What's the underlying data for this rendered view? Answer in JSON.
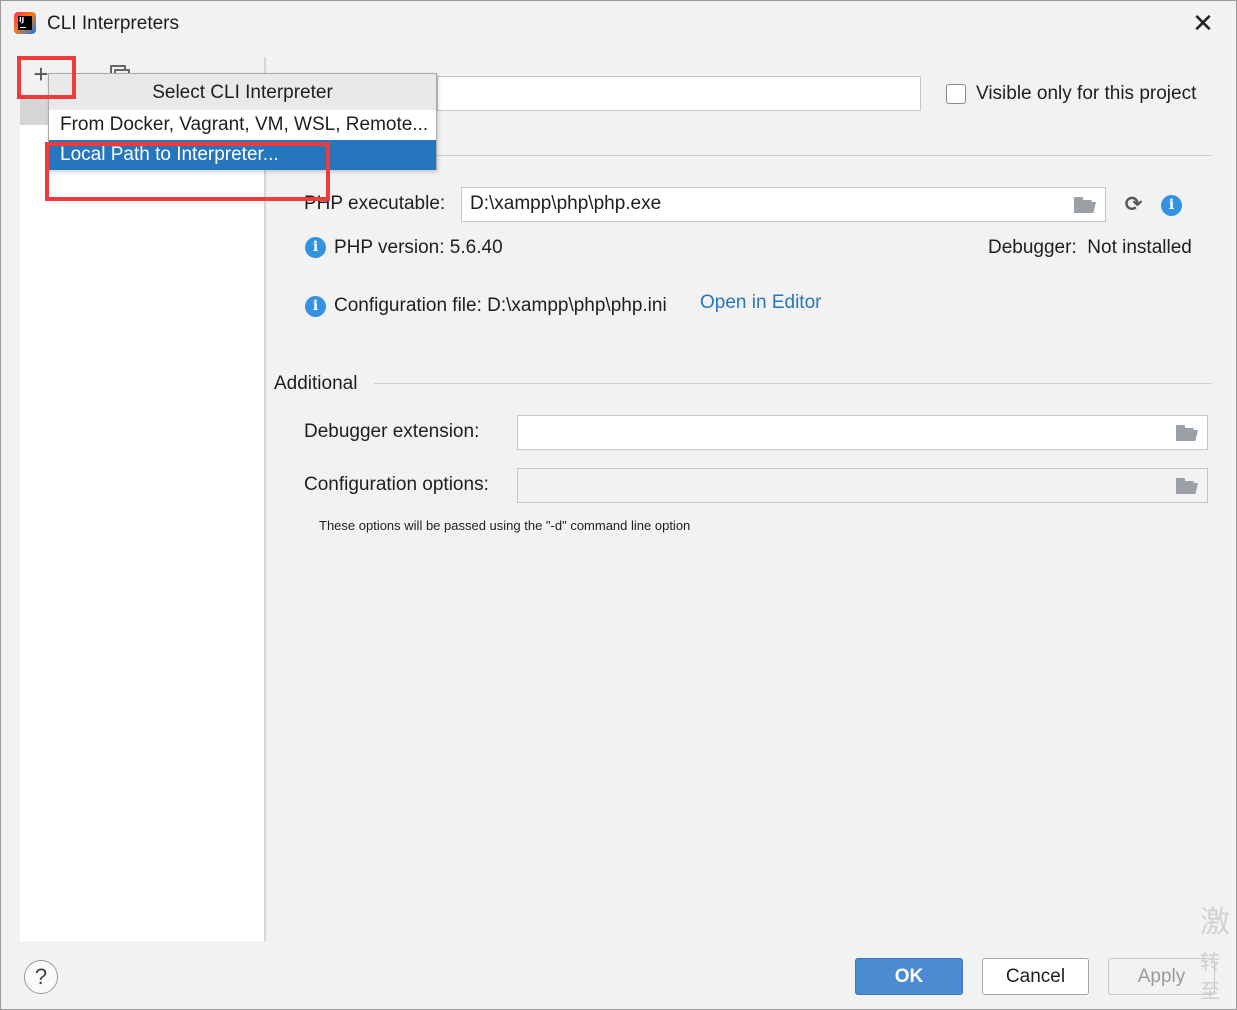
{
  "window": {
    "title": "CLI Interpreters",
    "close_glyph": "✕"
  },
  "left_panel": {
    "add_glyph": "+",
    "copy_icon": "copy-icon"
  },
  "popup": {
    "title": "Select CLI Interpreter",
    "items": [
      {
        "label": "From Docker, Vagrant, VM, WSL, Remote..."
      },
      {
        "label": "Local Path to Interpreter...",
        "selected": true
      }
    ]
  },
  "header": {
    "visible_only_label": "Visible only for this project",
    "visible_only_checked": false
  },
  "general": {
    "php_executable_label": "PHP executable:",
    "php_executable_value": "D:\\xampp\\php\\php.exe",
    "php_version_text": "PHP version: 5.6.40",
    "debugger_text": "Debugger:  Not installed",
    "config_file_text": "Configuration file: D:\\xampp\\php\\php.ini",
    "open_in_editor_link": "Open in Editor"
  },
  "additional": {
    "section_title": "Additional",
    "debugger_extension_label": "Debugger extension:",
    "debugger_extension_value": "",
    "configuration_options_label": "Configuration options:",
    "configuration_options_value": "",
    "note": "These options will be passed using the \"-d\" command line option"
  },
  "footer": {
    "help_glyph": "?",
    "ok_label": "OK",
    "cancel_label": "Cancel",
    "apply_label": "Apply"
  },
  "watermark": {
    "line1": "激",
    "line2": "转至"
  },
  "colors": {
    "accent": "#2675bf",
    "ok_button": "#4a8bd2",
    "highlight": "#ef3b3b",
    "info_icon": "#3592e0"
  }
}
